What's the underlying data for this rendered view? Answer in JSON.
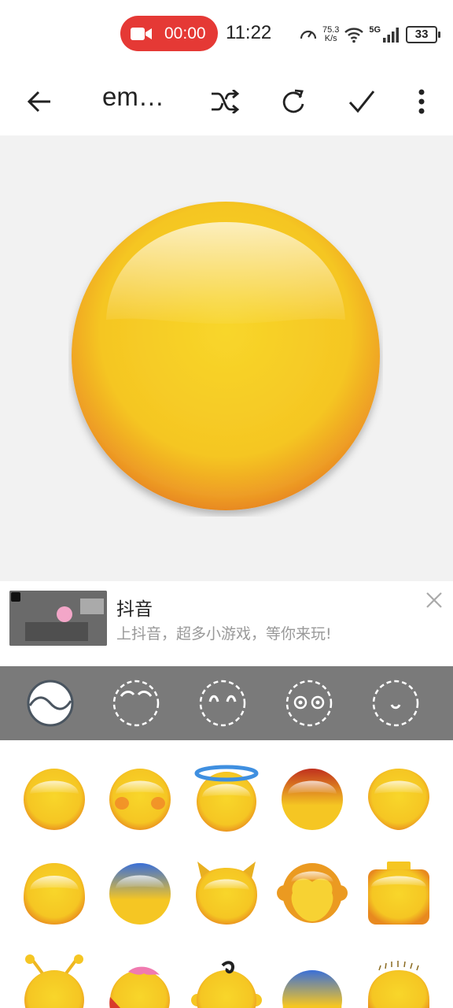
{
  "status_bar": {
    "record_time": "00:00",
    "clock": "11:22",
    "net_speed_value": "75.3",
    "net_speed_unit": "K/s",
    "network": "5G",
    "battery": "33"
  },
  "toolbar": {
    "title": "em…"
  },
  "ad": {
    "title": "抖音",
    "subtitle": "上抖音，超多小游戏，等你来玩!"
  },
  "categories": [
    "face-shape",
    "eyebrows",
    "eyes",
    "eyes-round",
    "mouth"
  ],
  "face_options": [
    "plain",
    "blush",
    "halo",
    "red-top",
    "drop",
    "wide",
    "blue-top",
    "cat",
    "monkey",
    "lego",
    "antenna",
    "pink-hair",
    "curl",
    "blue-hair",
    "fuzzy"
  ],
  "colors": {
    "face_yellow": "#f7c928",
    "face_orange": "#eb9a21",
    "record_red": "#e53935",
    "category_bar": "#7a7a7a",
    "preview_bg": "#f2f2f2"
  }
}
